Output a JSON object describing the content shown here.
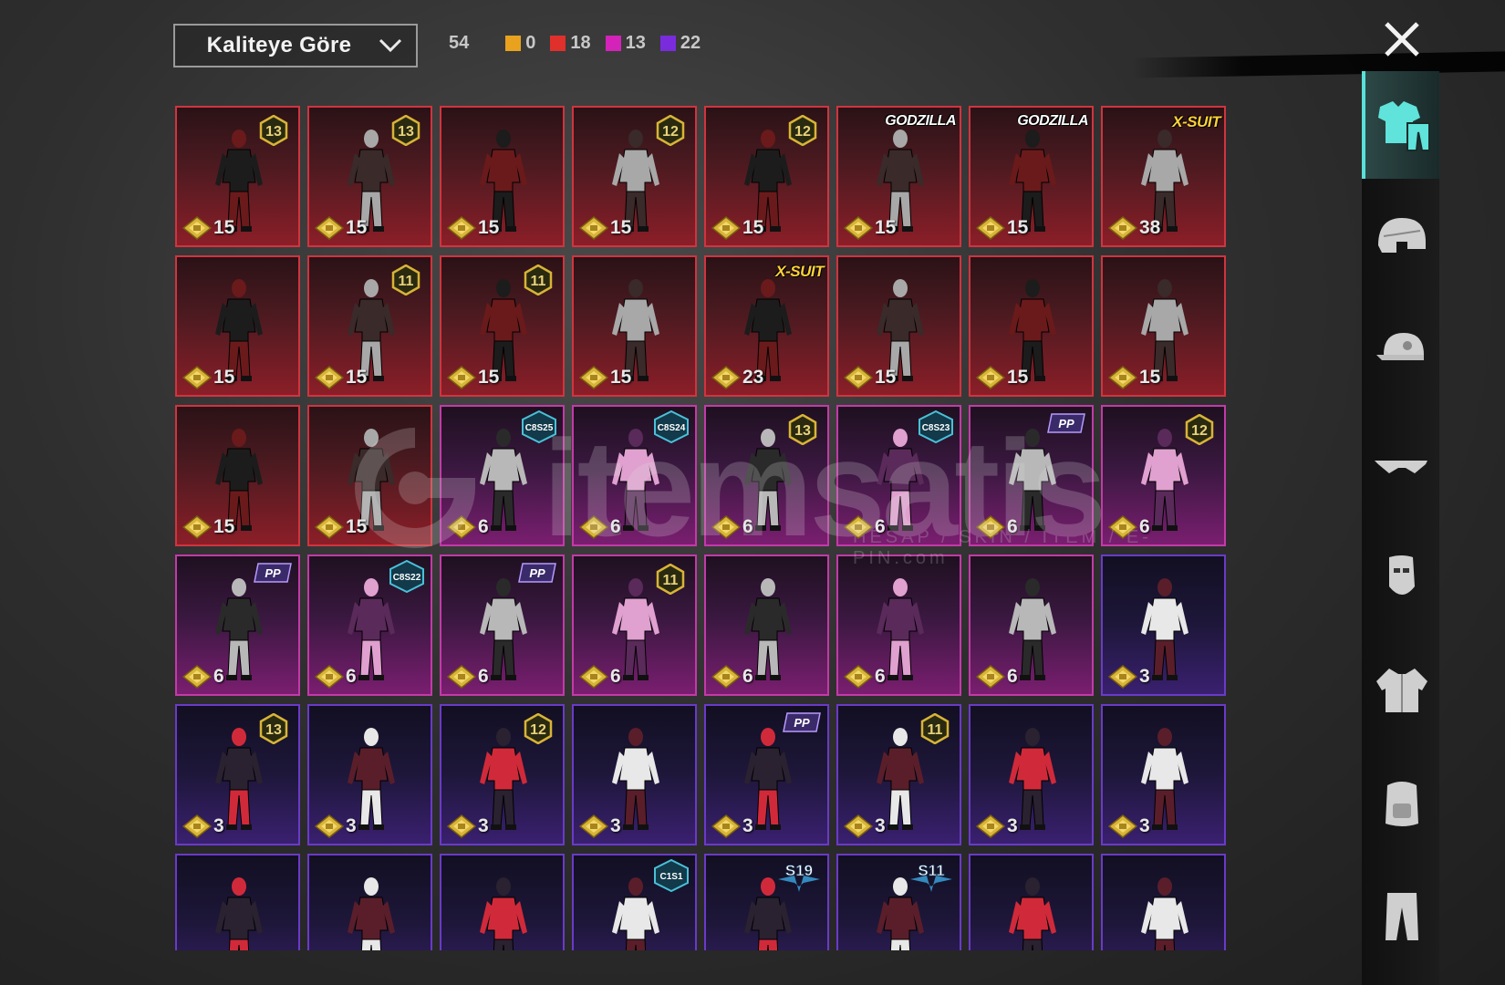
{
  "toolbar": {
    "sort_label": "Kaliteye Göre",
    "total": "54",
    "quality_counts": [
      {
        "color": "#e8a21e",
        "value": "0"
      },
      {
        "color": "#e0302c",
        "value": "18"
      },
      {
        "color": "#d423b8",
        "value": "13"
      },
      {
        "color": "#7a2cdc",
        "value": "22"
      }
    ]
  },
  "watermark": {
    "word": "itemsatis",
    "sub": "HESAP / SKIN / ITEM / E-PIN",
    "suffix": ".com"
  },
  "items": [
    {
      "q": "legendary",
      "price": "15",
      "badge": {
        "kind": "lvl",
        "text": "13"
      }
    },
    {
      "q": "legendary",
      "price": "15",
      "badge": {
        "kind": "lvl",
        "text": "13"
      }
    },
    {
      "q": "legendary",
      "price": "15",
      "badge": null
    },
    {
      "q": "legendary",
      "price": "15",
      "badge": {
        "kind": "lvl",
        "text": "12"
      }
    },
    {
      "q": "legendary",
      "price": "15",
      "badge": {
        "kind": "lvl",
        "text": "12"
      }
    },
    {
      "q": "legendary",
      "price": "15",
      "badge": {
        "kind": "text",
        "text": "GODZILLA"
      }
    },
    {
      "q": "legendary",
      "price": "15",
      "badge": {
        "kind": "text",
        "text": "GODZILLA"
      }
    },
    {
      "q": "legendary",
      "price": "38",
      "badge": {
        "kind": "xsuit",
        "text": "X-SUIT"
      }
    },
    {
      "q": "legendary",
      "price": "15",
      "badge": null
    },
    {
      "q": "legendary",
      "price": "15",
      "badge": {
        "kind": "lvl",
        "text": "11"
      }
    },
    {
      "q": "legendary",
      "price": "15",
      "badge": {
        "kind": "lvl",
        "text": "11"
      }
    },
    {
      "q": "legendary",
      "price": "15",
      "badge": null
    },
    {
      "q": "legendary",
      "price": "23",
      "badge": {
        "kind": "xsuit",
        "text": "X-SUIT"
      }
    },
    {
      "q": "legendary",
      "price": "15",
      "badge": null
    },
    {
      "q": "legendary",
      "price": "15",
      "badge": null
    },
    {
      "q": "legendary",
      "price": "15",
      "badge": null
    },
    {
      "q": "legendary",
      "price": "15",
      "badge": null
    },
    {
      "q": "legendary",
      "price": "15",
      "badge": null
    },
    {
      "q": "epic",
      "price": "6",
      "badge": {
        "kind": "hex",
        "text": "C8S25"
      }
    },
    {
      "q": "epic",
      "price": "6",
      "badge": {
        "kind": "hex",
        "text": "C8S24"
      }
    },
    {
      "q": "epic",
      "price": "6",
      "badge": {
        "kind": "lvl",
        "text": "13"
      }
    },
    {
      "q": "epic",
      "price": "6",
      "badge": {
        "kind": "hex",
        "text": "C8S23"
      }
    },
    {
      "q": "epic",
      "price": "6",
      "badge": {
        "kind": "pp",
        "text": "PP"
      }
    },
    {
      "q": "epic",
      "price": "6",
      "badge": {
        "kind": "lvl",
        "text": "12"
      }
    },
    {
      "q": "epic",
      "price": "6",
      "badge": {
        "kind": "pp",
        "text": "PP"
      }
    },
    {
      "q": "epic",
      "price": "6",
      "badge": {
        "kind": "hex",
        "text": "C8S22"
      }
    },
    {
      "q": "epic",
      "price": "6",
      "badge": {
        "kind": "pp",
        "text": "PP"
      }
    },
    {
      "q": "epic",
      "price": "6",
      "badge": {
        "kind": "lvl",
        "text": "11"
      }
    },
    {
      "q": "epic",
      "price": "6",
      "badge": null
    },
    {
      "q": "epic",
      "price": "6",
      "badge": null
    },
    {
      "q": "epic",
      "price": "6",
      "badge": null
    },
    {
      "q": "rare",
      "price": "3",
      "badge": null
    },
    {
      "q": "rare",
      "price": "3",
      "badge": {
        "kind": "lvl",
        "text": "13"
      }
    },
    {
      "q": "rare",
      "price": "3",
      "badge": null
    },
    {
      "q": "rare",
      "price": "3",
      "badge": {
        "kind": "lvl",
        "text": "12"
      }
    },
    {
      "q": "rare",
      "price": "3",
      "badge": null
    },
    {
      "q": "rare",
      "price": "3",
      "badge": {
        "kind": "pp",
        "text": "PP"
      }
    },
    {
      "q": "rare",
      "price": "3",
      "badge": {
        "kind": "lvl",
        "text": "11"
      }
    },
    {
      "q": "rare",
      "price": "3",
      "badge": null
    },
    {
      "q": "rare",
      "price": "3",
      "badge": null
    },
    {
      "q": "rare",
      "price": "",
      "badge": null
    },
    {
      "q": "rare",
      "price": "",
      "badge": null
    },
    {
      "q": "rare",
      "price": "",
      "badge": null
    },
    {
      "q": "rare",
      "price": "",
      "badge": {
        "kind": "hex",
        "text": "C1S1"
      }
    },
    {
      "q": "rare",
      "price": "",
      "badge": {
        "kind": "s",
        "text": "S19"
      }
    },
    {
      "q": "rare",
      "price": "",
      "badge": {
        "kind": "s",
        "text": "S11"
      }
    },
    {
      "q": "rare",
      "price": "",
      "badge": null
    },
    {
      "q": "rare",
      "price": "",
      "badge": null
    }
  ],
  "rail": [
    {
      "name": "outfit-category",
      "icon": "shirt-pants-icon",
      "active": true
    },
    {
      "name": "helmet-category",
      "icon": "helmet-icon",
      "active": false
    },
    {
      "name": "hat-category",
      "icon": "cap-icon",
      "active": false
    },
    {
      "name": "glasses-category",
      "icon": "sunglasses-icon",
      "active": false
    },
    {
      "name": "mask-category",
      "icon": "mask-icon",
      "active": false
    },
    {
      "name": "jacket-category",
      "icon": "jacket-icon",
      "active": false
    },
    {
      "name": "backpack-category",
      "icon": "backpack-icon",
      "active": false
    },
    {
      "name": "pants-category",
      "icon": "pants-icon",
      "active": false
    }
  ]
}
